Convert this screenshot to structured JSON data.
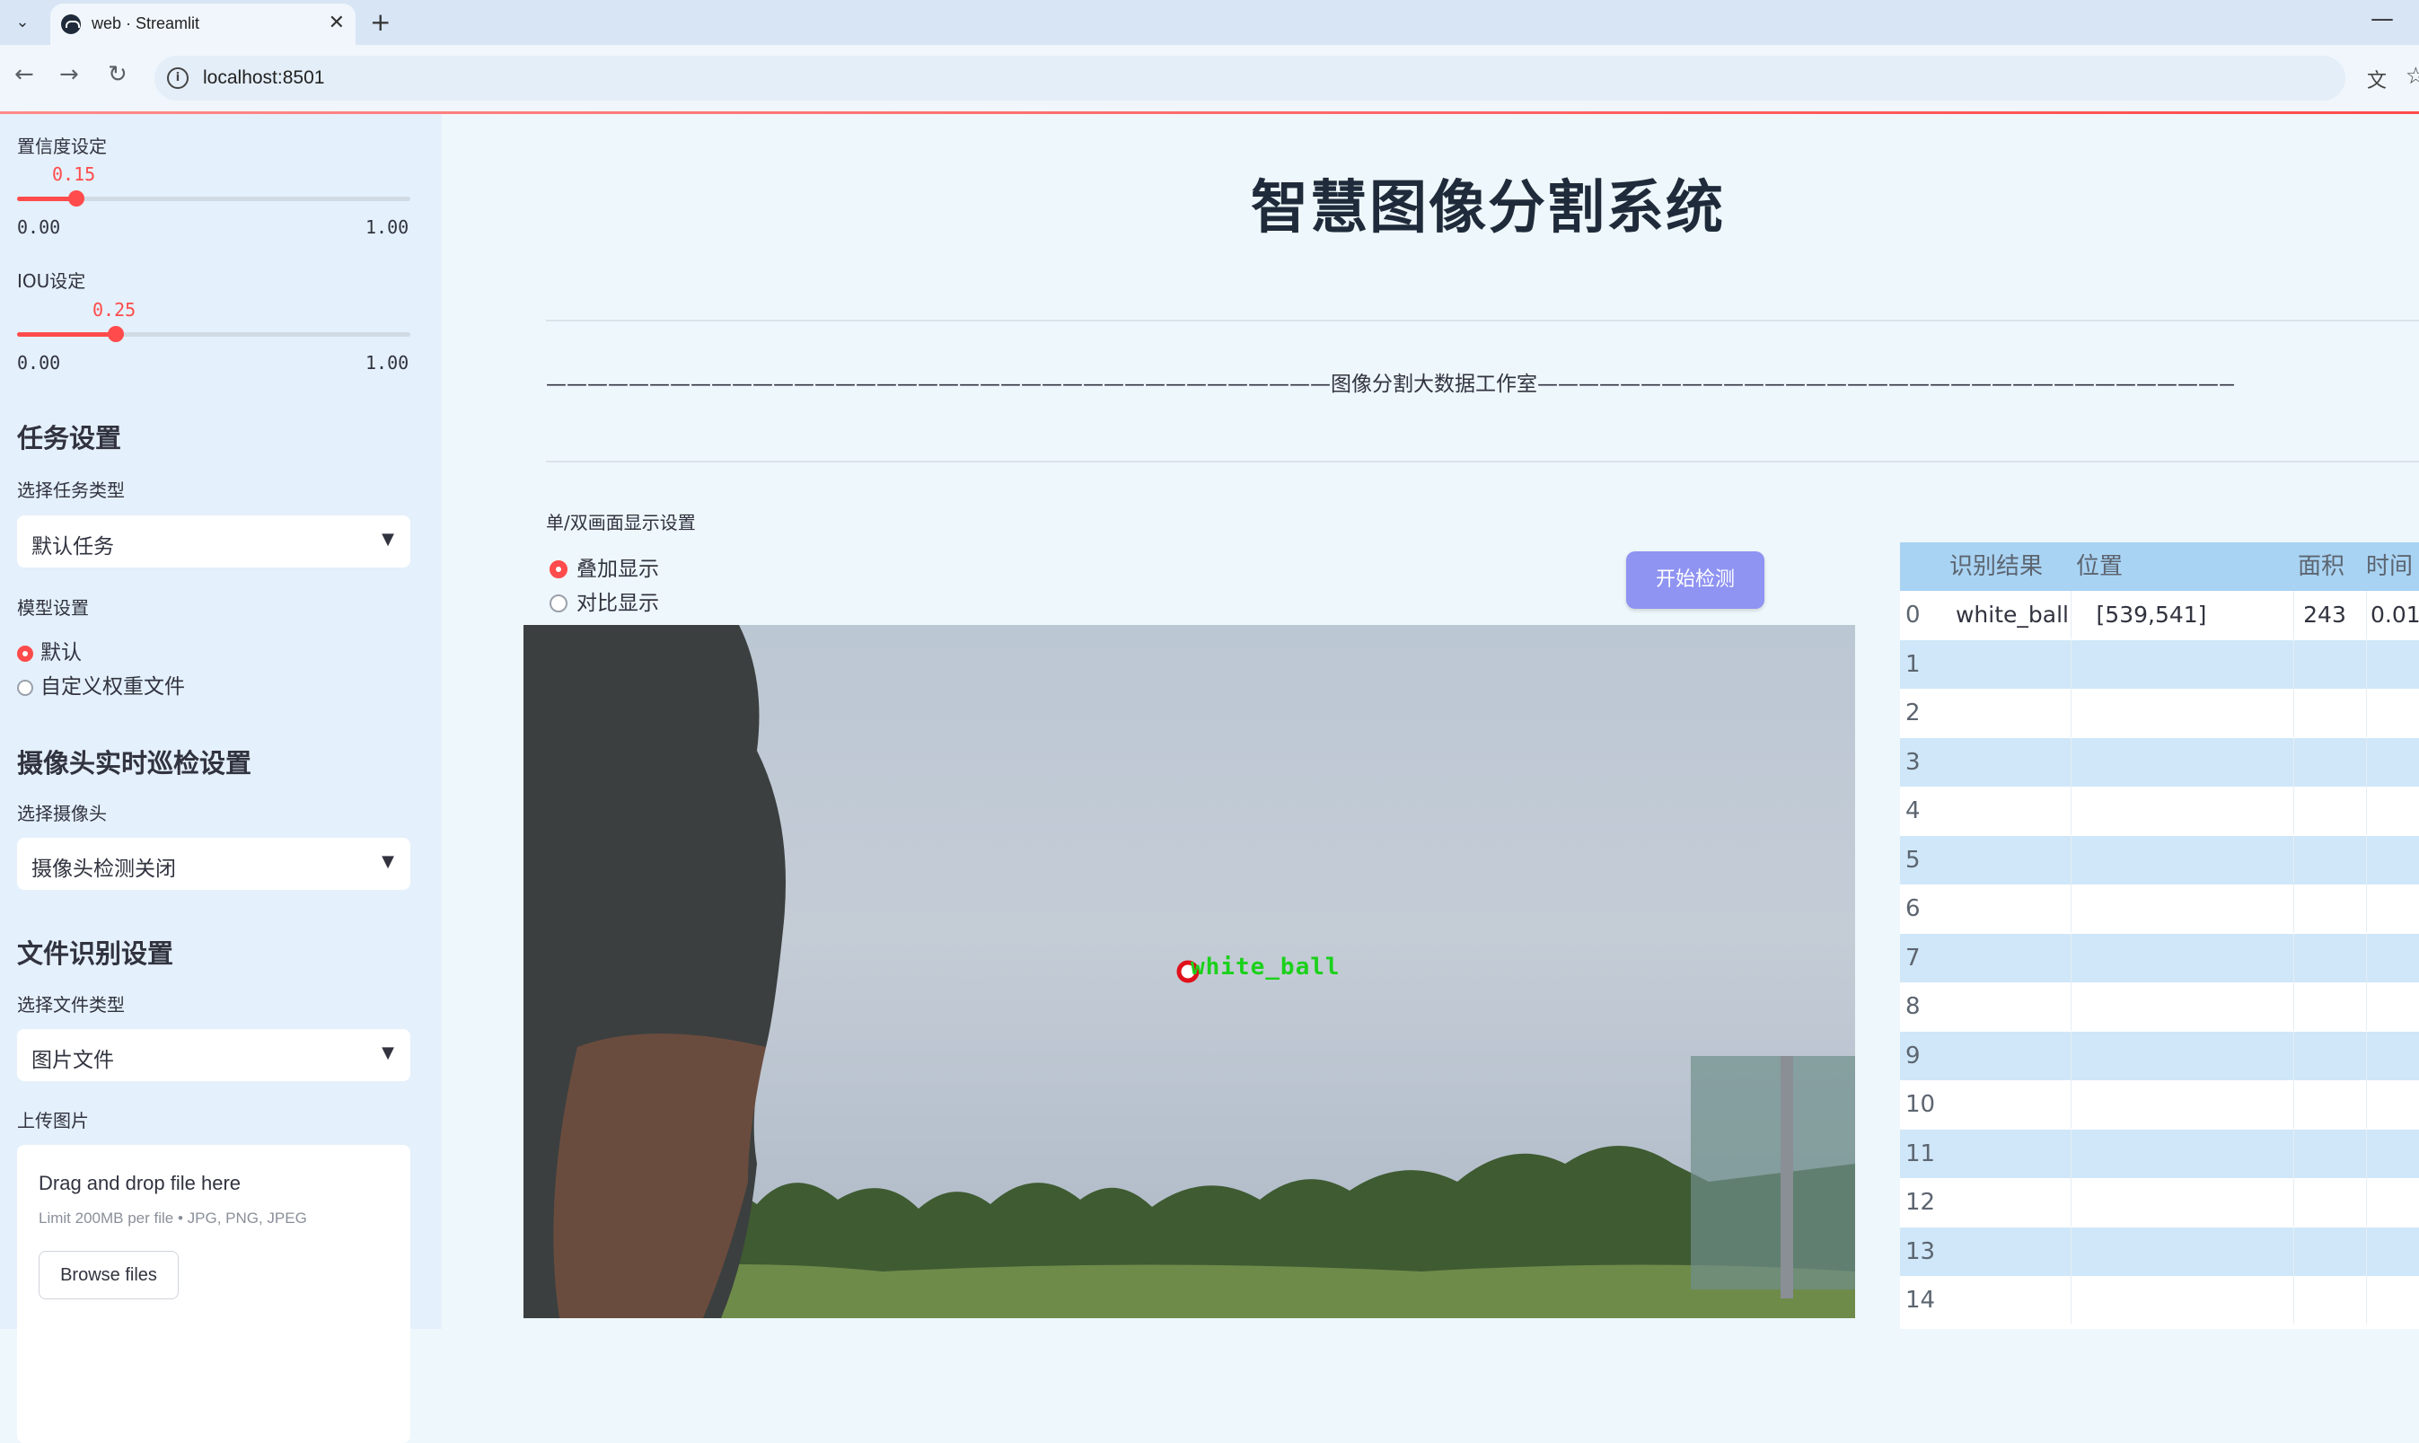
{
  "browser": {
    "tab_title": "web · Streamlit",
    "url": "localhost:8501"
  },
  "sidebar": {
    "confidence": {
      "label": "置信度设定",
      "value": "0.15",
      "min": "0.00",
      "max": "1.00",
      "fraction": 0.15
    },
    "iou": {
      "label": "IOU设定",
      "value": "0.25",
      "min": "0.00",
      "max": "1.00",
      "fraction": 0.25
    },
    "task_section": {
      "heading": "任务设置",
      "select_label": "选择任务类型",
      "selected": "默认任务"
    },
    "model_section": {
      "label": "模型设置",
      "options": [
        "默认",
        "自定义权重文件"
      ],
      "selected_index": 0
    },
    "camera_section": {
      "heading": "摄像头实时巡检设置",
      "select_label": "选择摄像头",
      "selected": "摄像头检测关闭"
    },
    "file_section": {
      "heading": "文件识别设置",
      "select_label": "选择文件类型",
      "selected": "图片文件",
      "upload_label": "上传图片"
    },
    "uploader": {
      "title": "Drag and drop file here",
      "subtitle": "Limit 200MB per file • JPG, PNG, JPEG",
      "button": "Browse files"
    }
  },
  "main": {
    "title": "智慧图像分割系统",
    "divider_text": "——————————————————————————————————————图像分割大数据工作室———————————————————————————————————————",
    "display_setting_label": "单/双画面显示设置",
    "display_options": [
      "叠加显示",
      "对比显示"
    ],
    "display_selected_index": 0,
    "start_button": "开始检测",
    "detection_label": "white_ball"
  },
  "table": {
    "headers": [
      "识别结果",
      "位置",
      "面积",
      "时间"
    ],
    "rows": [
      {
        "index": "0",
        "result": "white_ball",
        "position": "[539,541]",
        "area": "243",
        "time": "0.01"
      },
      {
        "index": "1"
      },
      {
        "index": "2"
      },
      {
        "index": "3"
      },
      {
        "index": "4"
      },
      {
        "index": "5"
      },
      {
        "index": "6"
      },
      {
        "index": "7"
      },
      {
        "index": "8"
      },
      {
        "index": "9"
      },
      {
        "index": "10"
      },
      {
        "index": "11"
      },
      {
        "index": "12"
      },
      {
        "index": "13"
      },
      {
        "index": "14"
      }
    ]
  },
  "colors": {
    "accent": "#ff4b4b",
    "button": "#8f93f2",
    "sidebar_bg": "#e4f0fb",
    "table_header": "#a9d3f3"
  },
  "icons": [
    "tab-menu-icon",
    "streamlit-favicon-icon",
    "close-icon",
    "plus-icon",
    "minimize-icon",
    "back-arrow-icon",
    "forward-arrow-icon",
    "reload-icon",
    "info-icon",
    "translate-icon",
    "star-icon",
    "chevron-down-icon"
  ]
}
